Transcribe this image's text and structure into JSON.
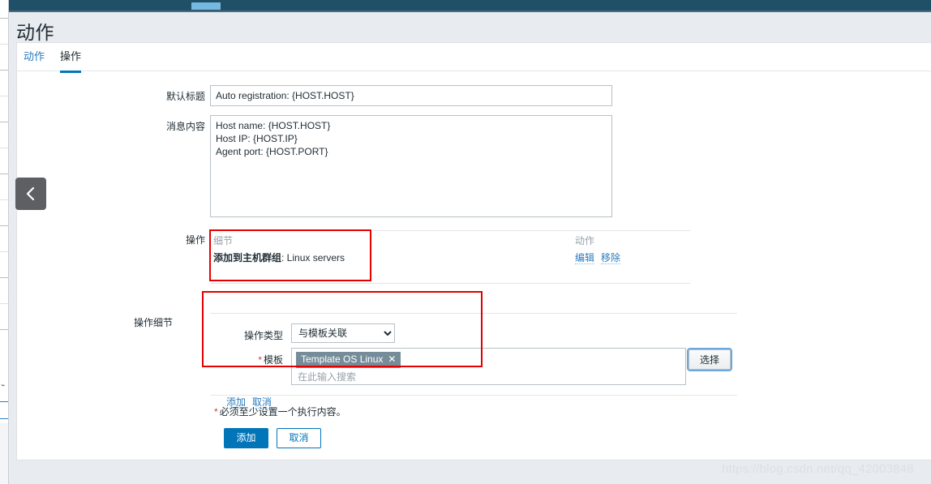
{
  "window": {
    "top_bar_color": "#1f5068",
    "active_tab_indicator_color": "#76b9e0"
  },
  "header": {
    "page_title": "动作"
  },
  "tabs": [
    {
      "label": "动作",
      "active": false
    },
    {
      "label": "操作",
      "active": true
    }
  ],
  "form": {
    "default_subject": {
      "label": "默认标题",
      "value": "Auto registration: {HOST.HOST}"
    },
    "message_body": {
      "label": "消息内容",
      "value": "Host name: {HOST.HOST}\nHost IP: {HOST.IP}\nAgent port: {HOST.PORT}"
    },
    "operations": {
      "label": "操作",
      "columns": [
        "细节",
        "动作"
      ],
      "rows": [
        {
          "details_bold": "添加到主机群组",
          "details_rest": ": Linux servers",
          "actions": [
            "编辑",
            "移除"
          ]
        }
      ]
    },
    "operation_details": {
      "label": "操作细节",
      "operation_type": {
        "label": "操作类型",
        "selected": "与模板关联",
        "options": [
          "与模板关联"
        ]
      },
      "template": {
        "label": "模板",
        "required_marker": "*",
        "chips": [
          {
            "text": "Template OS Linux",
            "remove_icon": "✕"
          }
        ],
        "placeholder": "在此输入搜索",
        "select_button": "选择"
      },
      "inline_links": [
        "添加",
        "取消"
      ]
    },
    "footnote": {
      "marker": "*",
      "text": "必须至少设置一个执行内容。"
    },
    "footer_buttons": {
      "primary": "添加",
      "secondary": "取消"
    }
  },
  "sidebar_toggle": {
    "icon": "chevron-left-icon",
    "color": "#5d5f62"
  },
  "annotations": {
    "highlight_color": "#e60000",
    "boxes": [
      "operations-details-cell",
      "operation-details-fields"
    ]
  },
  "watermark": {
    "text": "https://blog.csdn.net/qq_42003848"
  }
}
